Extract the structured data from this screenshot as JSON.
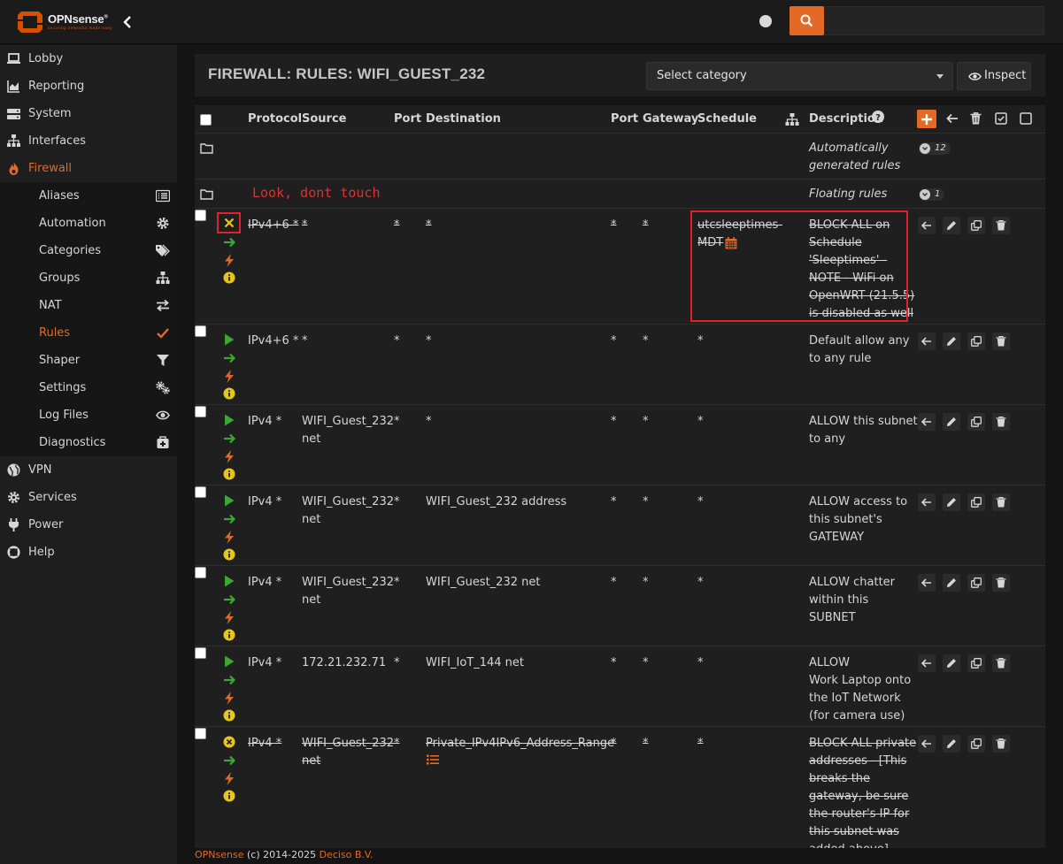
{
  "topbar": {
    "brand": "OPNsense",
    "brand_mark": "®",
    "tagline": "securing networks made easy",
    "search_placeholder": ""
  },
  "sidebar": {
    "items": [
      {
        "label": "Lobby",
        "icon": "laptop-icon"
      },
      {
        "label": "Reporting",
        "icon": "area-chart-icon"
      },
      {
        "label": "System",
        "icon": "server-icon"
      },
      {
        "label": "Interfaces",
        "icon": "sitemap-icon"
      },
      {
        "label": "Firewall",
        "icon": "fire-icon"
      }
    ],
    "firewall_sub": [
      {
        "label": "Aliases",
        "icon": "list-alt-icon"
      },
      {
        "label": "Automation",
        "icon": "gear-icon"
      },
      {
        "label": "Categories",
        "icon": "tags-icon"
      },
      {
        "label": "Groups",
        "icon": "sitemap-icon"
      },
      {
        "label": "NAT",
        "icon": "exchange-icon"
      },
      {
        "label": "Rules",
        "icon": "check-icon"
      },
      {
        "label": "Shaper",
        "icon": "filter-icon"
      },
      {
        "label": "Settings",
        "icon": "gears-icon"
      },
      {
        "label": "Log Files",
        "icon": "eye-icon"
      },
      {
        "label": "Diagnostics",
        "icon": "medkit-icon"
      }
    ],
    "items_after": [
      {
        "label": "VPN",
        "icon": "globe-icon"
      },
      {
        "label": "Services",
        "icon": "cog-icon"
      },
      {
        "label": "Power",
        "icon": "plug-icon"
      },
      {
        "label": "Help",
        "icon": "life-ring-icon"
      }
    ]
  },
  "header": {
    "title": "FIREWALL: RULES: WIFI_GUEST_232",
    "category_placeholder": "Select category",
    "inspect_label": "Inspect"
  },
  "table": {
    "columns": {
      "protocol": "Protocol",
      "source": "Source",
      "port": "Port",
      "destination": "Destination",
      "dport": "Port",
      "gateway": "Gateway",
      "schedule": "Schedule",
      "description": "Description"
    },
    "auto_group": {
      "label_line1": "Automatically",
      "label_line2": "generated rules",
      "count": "12"
    },
    "floating_group": {
      "label": "Floating rules",
      "count": "1"
    },
    "rules": [
      {
        "proto": "IPv4+6 *",
        "src": "*",
        "sport": "*",
        "dst": "*",
        "dport": "*",
        "gw": "*",
        "sched_line1": "utcsleeptimes-",
        "sched_line2": "MDT",
        "desc": [
          "BLOCK ALL on",
          "Schedule",
          "'Sleeptimes' -",
          "NOTE - WiFi on",
          "OpenWRT (21.5.5)",
          "is disabled as well"
        ],
        "disabled": true,
        "action": "block"
      },
      {
        "proto": "IPv4+6 *",
        "src": "*",
        "sport": "*",
        "dst": "*",
        "dport": "*",
        "gw": "*",
        "sched": "*",
        "desc": [
          "Default allow any",
          "to any rule"
        ],
        "disabled": false,
        "action": "pass"
      },
      {
        "proto": "IPv4 *",
        "src_line1": "WIFI_Guest_232",
        "src_line2": "net",
        "sport": "*",
        "dst": "*",
        "dport": "*",
        "gw": "*",
        "sched": "*",
        "desc": [
          "ALLOW this subnet",
          "to any"
        ],
        "disabled": false,
        "action": "pass"
      },
      {
        "proto": "IPv4 *",
        "src_line1": "WIFI_Guest_232",
        "src_line2": "net",
        "sport": "*",
        "dst": "WIFI_Guest_232 address",
        "dport": "*",
        "gw": "*",
        "sched": "*",
        "desc": [
          "ALLOW access to",
          "this subnet's",
          "GATEWAY"
        ],
        "disabled": false,
        "action": "pass"
      },
      {
        "proto": "IPv4 *",
        "src_line1": "WIFI_Guest_232",
        "src_line2": "net",
        "sport": "*",
        "dst": "WIFI_Guest_232 net",
        "dport": "*",
        "gw": "*",
        "sched": "*",
        "desc": [
          "ALLOW chatter",
          "within this",
          "SUBNET"
        ],
        "disabled": false,
        "action": "pass"
      },
      {
        "proto": "IPv4 *",
        "src": "172.21.232.71",
        "sport": "*",
        "dst": "WIFI_IoT_144 net",
        "dport": "*",
        "gw": "*",
        "sched": "*",
        "desc": [
          "ALLOW",
          "Work Laptop onto",
          "the IoT Network",
          "(for camera use)"
        ],
        "disabled": false,
        "action": "pass"
      },
      {
        "proto": "IPv4 *",
        "src_line1": "WIFI_Guest_232",
        "src_line2": "net",
        "sport": "*",
        "dst": "Private_IPv4IPv6_Address_Range",
        "dport": "*",
        "gw": "*",
        "sched": "*",
        "desc": [
          "BLOCK ALL private",
          "addresses - [This",
          "breaks the",
          "gateway, be sure",
          "the router's IP for",
          "this subnet was",
          "added above]"
        ],
        "disabled": true,
        "action": "block"
      }
    ]
  },
  "annotation": {
    "note": "Look, dont touch"
  },
  "footer": {
    "brand": "OPNsense",
    "copy": " (c) 2014-2025 ",
    "company": "Deciso B.V."
  },
  "colors": {
    "accent": "#e26a26",
    "pass": "#3aa832",
    "block": "#e6c619",
    "annotation": "#e0202a"
  }
}
